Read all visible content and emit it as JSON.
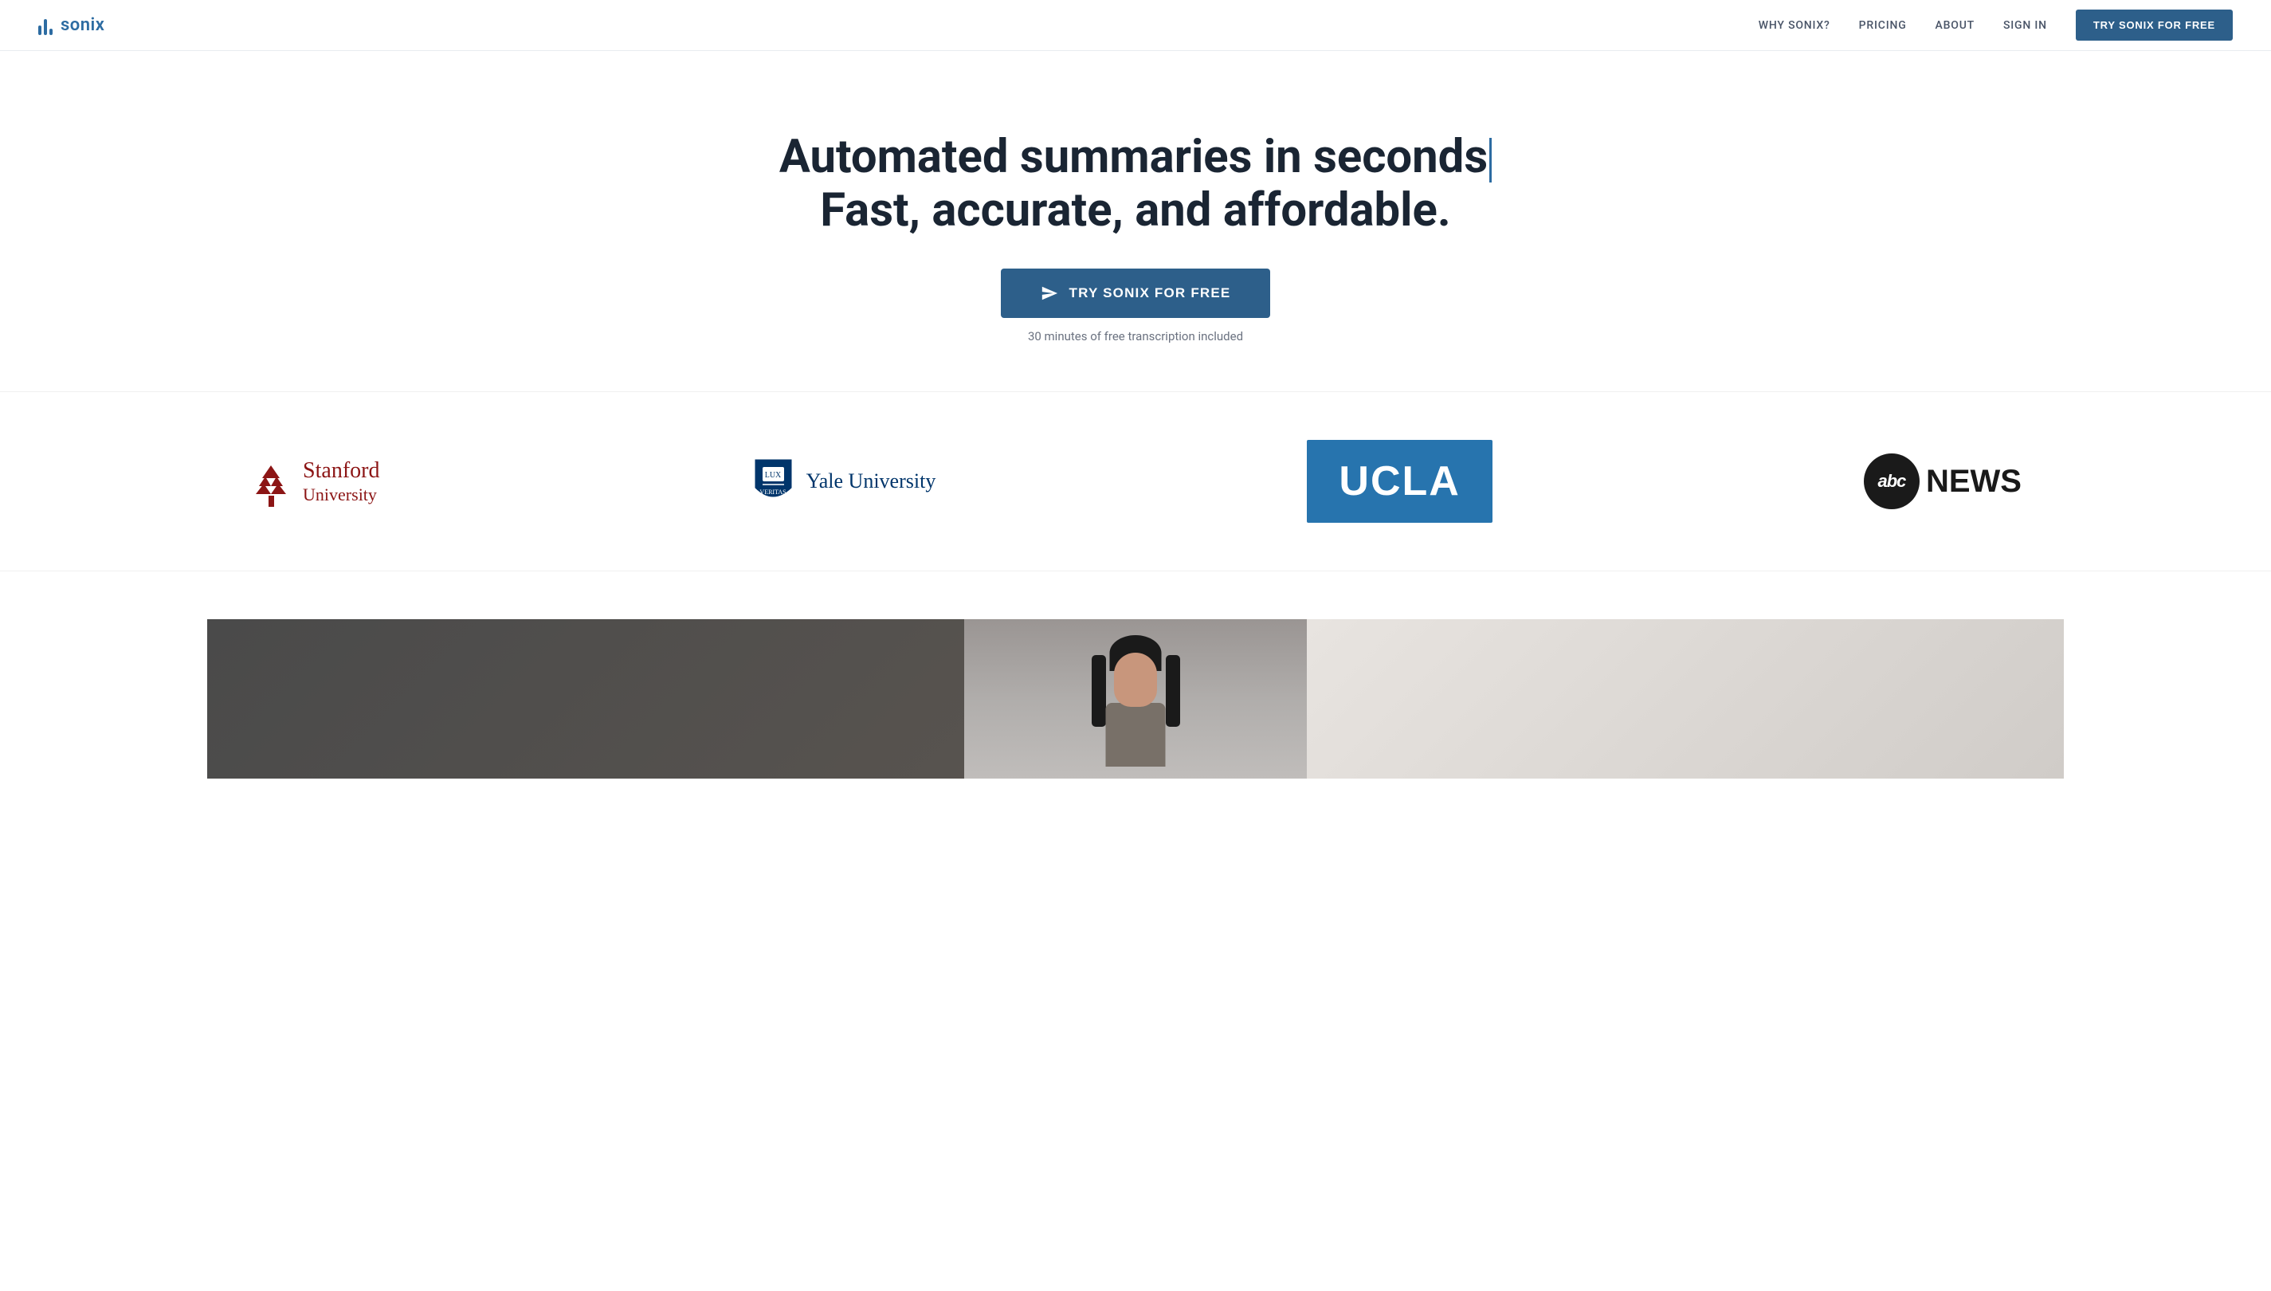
{
  "nav": {
    "logo_text": "sonix",
    "links": [
      {
        "id": "why-sonix",
        "label": "WHY SONIX?"
      },
      {
        "id": "pricing",
        "label": "PRICING"
      },
      {
        "id": "about",
        "label": "ABOUT"
      },
      {
        "id": "sign-in",
        "label": "SIGN IN"
      }
    ],
    "cta_label": "TRY SONIX FOR FREE"
  },
  "hero": {
    "title_line1": "Automated summaries in seconds",
    "title_line2": "Fast, accurate, and affordable.",
    "cta_label": "TRY SONIX FOR FREE",
    "subtext": "30 minutes of free transcription included"
  },
  "logos": {
    "stanford": {
      "name": "Stanford",
      "university": "University"
    },
    "yale": {
      "name": "Yale University"
    },
    "ucla": {
      "text": "UCLA"
    },
    "abc_news": {
      "abc": "abc",
      "news": "NEWS"
    }
  },
  "colors": {
    "brand_blue": "#2d5f8a",
    "stanford_red": "#8c1515",
    "yale_blue": "#00356b",
    "ucla_blue": "#2774AE",
    "abc_dark": "#1a1a1a"
  }
}
